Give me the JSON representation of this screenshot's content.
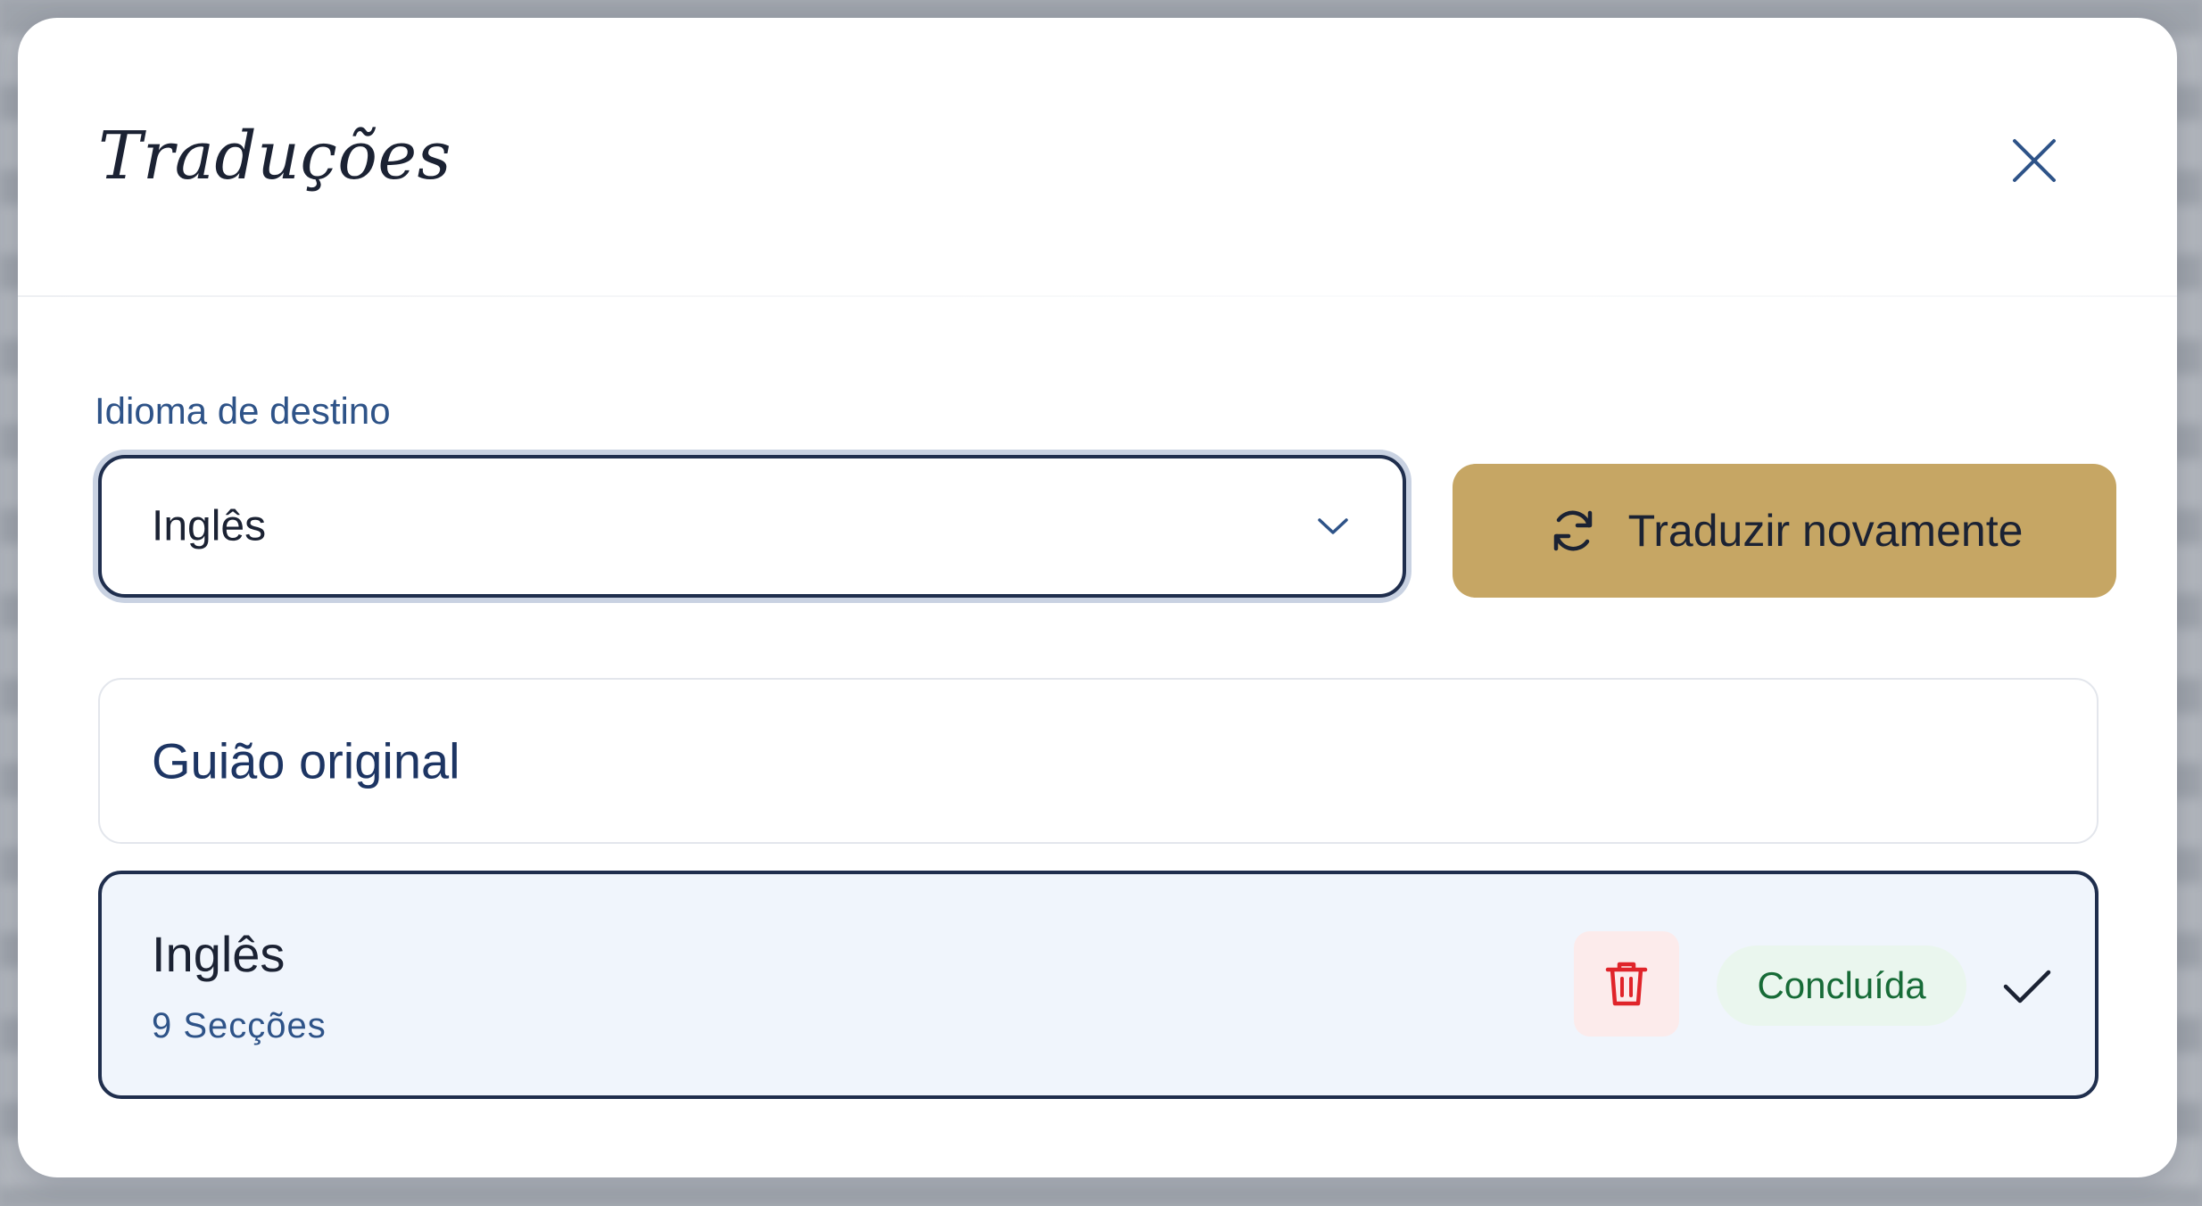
{
  "dialog": {
    "title": "Traduções",
    "close_icon": "close-icon"
  },
  "target_language": {
    "label": "Idioma de destino",
    "selected": "Inglês",
    "chevron_icon": "chevron-down-icon"
  },
  "retranslate_button": {
    "label": "Traduzir novamente",
    "icon": "refresh-icon"
  },
  "translations": [
    {
      "title": "Guião original"
    },
    {
      "title": "Inglês",
      "subtitle": "9 Secções",
      "status": "Concluída",
      "delete_icon": "trash-icon",
      "check_icon": "check-icon"
    }
  ],
  "colors": {
    "accent_gold": "#c6a664",
    "navy": "#1f2e4d",
    "label_blue": "#2e5388",
    "success_green": "#176b37",
    "danger_red": "#e0242a"
  }
}
